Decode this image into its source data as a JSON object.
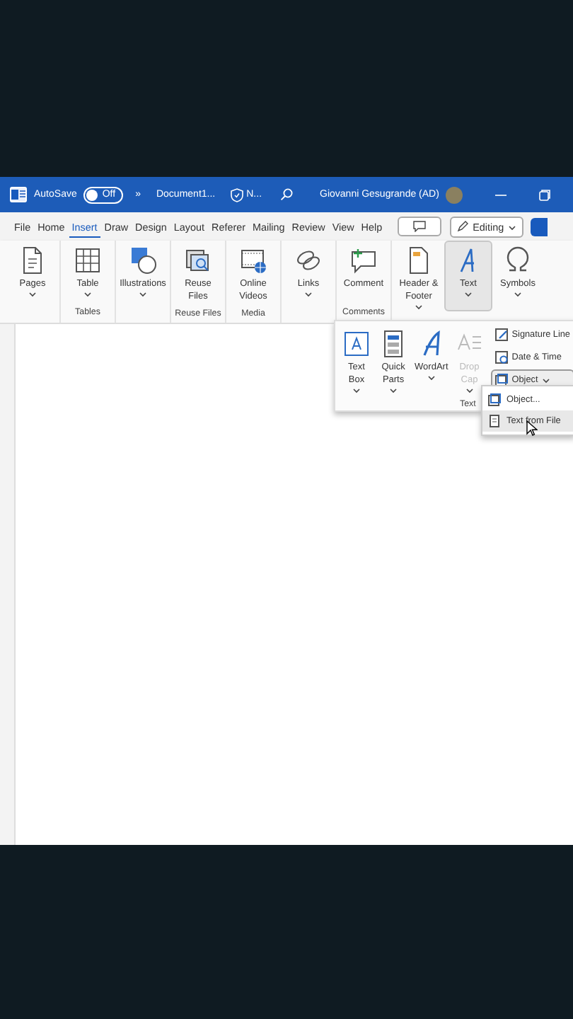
{
  "title_bar": {
    "autosave_label": "AutoSave",
    "autosave_toggle": {
      "label": "Off",
      "on": false
    },
    "more": "»",
    "document": "Document1...",
    "sensitivity": "N...",
    "user": "Giovanni Gesugrande (AD)"
  },
  "menu_tabs": [
    {
      "label": "File",
      "selected": false
    },
    {
      "label": "Home",
      "selected": false
    },
    {
      "label": "Insert",
      "selected": true
    },
    {
      "label": "Draw",
      "selected": false
    },
    {
      "label": "Design",
      "selected": false
    },
    {
      "label": "Layout",
      "selected": false
    },
    {
      "label": "Referer",
      "selected": false
    },
    {
      "label": "Mailing",
      "selected": false
    },
    {
      "label": "Review",
      "selected": false
    },
    {
      "label": "View",
      "selected": false
    },
    {
      "label": "Help",
      "selected": false
    }
  ],
  "editing_button": "Editing",
  "ribbon_groups": [
    {
      "items": [
        {
          "label": "Pages",
          "caret": true,
          "selected": false
        }
      ]
    },
    {
      "label": "Tables",
      "items": [
        {
          "label": "Table",
          "caret": true,
          "selected": false
        }
      ]
    },
    {
      "items": [
        {
          "label": "Illustrations",
          "caret": true,
          "selected": false
        }
      ]
    },
    {
      "label": "Reuse Files",
      "items": [
        {
          "label": "Reuse Files",
          "caret": false,
          "selected": false
        }
      ]
    },
    {
      "label": "Media",
      "items": [
        {
          "label": "Online Videos",
          "caret": false,
          "selected": false
        }
      ]
    },
    {
      "items": [
        {
          "label": "Links",
          "caret": true,
          "selected": false
        }
      ]
    },
    {
      "label": "Comments",
      "items": [
        {
          "label": "Comment",
          "caret": false,
          "selected": false
        }
      ]
    },
    {
      "items": [
        {
          "label": "Header & Footer",
          "caret": true,
          "selected": false
        },
        {
          "label": "Text",
          "caret": true,
          "selected": true
        },
        {
          "label": "Symbols",
          "caret": true,
          "selected": false
        }
      ]
    }
  ],
  "text_panel": {
    "label": "Text",
    "large_items": [
      {
        "label": "Text Box",
        "disabled": false
      },
      {
        "label": "Quick Parts",
        "disabled": false
      },
      {
        "label": "WordArt",
        "disabled": false
      },
      {
        "label": "Drop Cap",
        "disabled": true
      }
    ],
    "small_items": [
      {
        "label": "Signature Line",
        "expanded": false
      },
      {
        "label": "Date & Time",
        "expanded": false
      },
      {
        "label": "Object",
        "expanded": true
      }
    ]
  },
  "object_menu": [
    {
      "label": "Object...",
      "selected": false
    },
    {
      "label": "Text from File",
      "selected": true
    }
  ]
}
